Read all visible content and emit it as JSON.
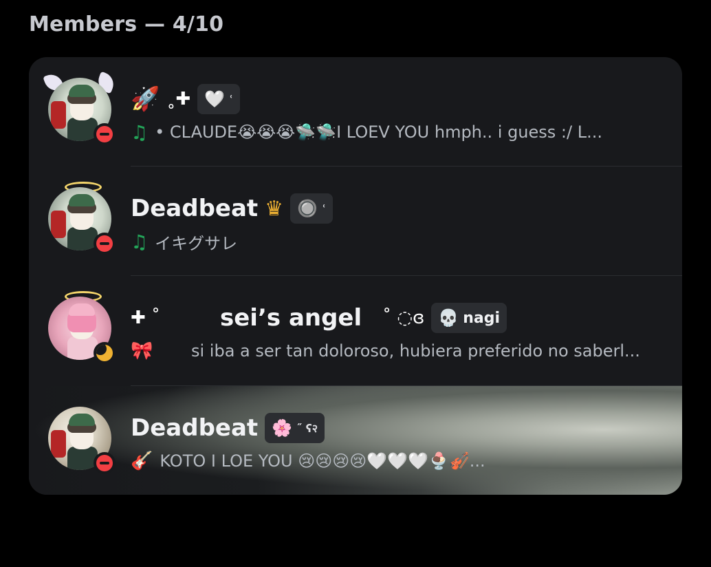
{
  "header": {
    "title": "Members — 4/10"
  },
  "members": [
    {
      "name_prefix": "🚀",
      "name_deco": "˳✚",
      "tag_emblem": "🤍",
      "tag_suffix": "ʿ",
      "activity_icon": "♫",
      "status_text": "• CLAUDE😭😭😭🛸🛸I LOEV YOU hmph.. i guess :/ L..."
    },
    {
      "name": "Deadbeat",
      "crown": "♛",
      "tag_emblem": "🔘",
      "tag_suffix": "ʿ",
      "activity_icon": "♫",
      "status_text": "イキグサレ"
    },
    {
      "name_deco": "✚ ˚",
      "name": "sei’s angel",
      "name_suffix": "˚ ◌ɞ",
      "tag_emblem": "💀",
      "tag_text": "nagi",
      "activity_icon": "🎀",
      "status_text": "si iba a ser tan doloroso, hubiera preferido no saberl..."
    },
    {
      "name": "Deadbeat",
      "tag_emblem": "🌸",
      "tag_suffix": "˝ ʕ२",
      "activity_icon": "🎸",
      "status_text": "KOTO I LOE YOU 😢😢😢😢🤍🤍🤍🍨🎻..."
    }
  ]
}
